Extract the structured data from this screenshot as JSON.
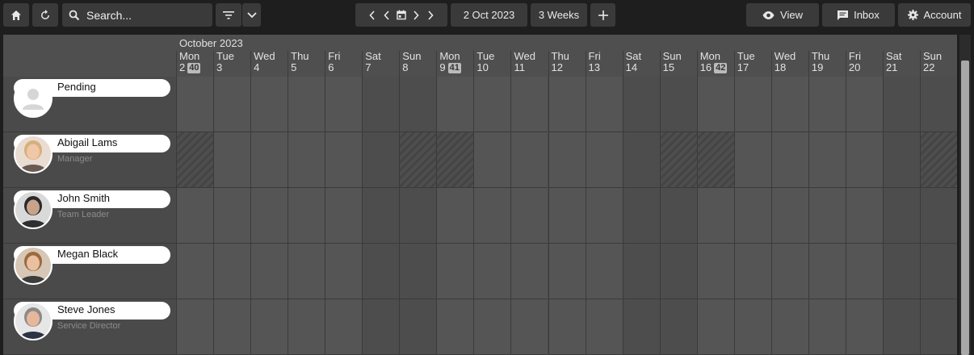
{
  "toolbar": {
    "search_placeholder": "Search...",
    "current_date": "2 Oct 2023",
    "range": "3 Weeks",
    "view_label": "View",
    "inbox_label": "Inbox",
    "account_label": "Account"
  },
  "calendar": {
    "month": "October 2023",
    "days": [
      {
        "dn": "Mon",
        "dd": "2",
        "week": "40",
        "weekend": false
      },
      {
        "dn": "Tue",
        "dd": "3",
        "week": "",
        "weekend": false
      },
      {
        "dn": "Wed",
        "dd": "4",
        "week": "",
        "weekend": false
      },
      {
        "dn": "Thu",
        "dd": "5",
        "week": "",
        "weekend": false
      },
      {
        "dn": "Fri",
        "dd": "6",
        "week": "",
        "weekend": false
      },
      {
        "dn": "Sat",
        "dd": "7",
        "week": "",
        "weekend": true
      },
      {
        "dn": "Sun",
        "dd": "8",
        "week": "",
        "weekend": true
      },
      {
        "dn": "Mon",
        "dd": "9",
        "week": "41",
        "weekend": false
      },
      {
        "dn": "Tue",
        "dd": "10",
        "week": "",
        "weekend": false
      },
      {
        "dn": "Wed",
        "dd": "11",
        "week": "",
        "weekend": false
      },
      {
        "dn": "Thu",
        "dd": "12",
        "week": "",
        "weekend": false
      },
      {
        "dn": "Fri",
        "dd": "13",
        "week": "",
        "weekend": false
      },
      {
        "dn": "Sat",
        "dd": "14",
        "week": "",
        "weekend": true
      },
      {
        "dn": "Sun",
        "dd": "15",
        "week": "",
        "weekend": true
      },
      {
        "dn": "Mon",
        "dd": "16",
        "week": "42",
        "weekend": false
      },
      {
        "dn": "Tue",
        "dd": "17",
        "week": "",
        "weekend": false
      },
      {
        "dn": "Wed",
        "dd": "18",
        "week": "",
        "weekend": false
      },
      {
        "dn": "Thu",
        "dd": "19",
        "week": "",
        "weekend": false
      },
      {
        "dn": "Fri",
        "dd": "20",
        "week": "",
        "weekend": false
      },
      {
        "dn": "Sat",
        "dd": "21",
        "week": "",
        "weekend": true
      },
      {
        "dn": "Sun",
        "dd": "22",
        "week": "",
        "weekend": true
      }
    ]
  },
  "resources": [
    {
      "name": "Pending",
      "role": "",
      "avatar": "placeholder",
      "unavailable": []
    },
    {
      "name": "Abigail Lams",
      "role": "Manager",
      "avatar": "photo-blonde",
      "unavailable": [
        0,
        6,
        7,
        13,
        14,
        20
      ]
    },
    {
      "name": "John Smith",
      "role": "Team Leader",
      "avatar": "photo-man-dark",
      "unavailable": []
    },
    {
      "name": "Megan Black",
      "role": "",
      "avatar": "photo-woman-brown",
      "unavailable": []
    },
    {
      "name": "Steve Jones",
      "role": "Service Director",
      "avatar": "photo-man-grey",
      "unavailable": []
    }
  ]
}
